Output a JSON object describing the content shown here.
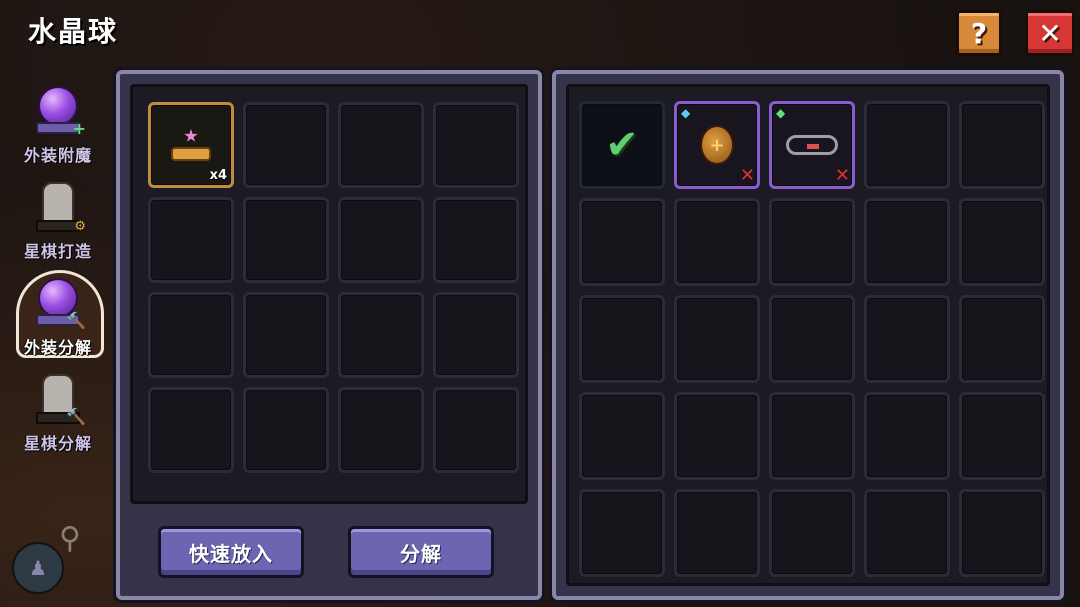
{
  "header": {
    "title": "水晶球",
    "help_label": "?",
    "close_label": "✕"
  },
  "colors": {
    "help_button": "#d88a3a",
    "close_button": "#d63636",
    "action_button": "#6c66b2",
    "panel": "#35324a"
  },
  "sidebar": {
    "items": [
      {
        "label": "外装附魔",
        "icon": "purple-crystal-orb-icon",
        "badge": "+",
        "active": false
      },
      {
        "label": "星棋打造",
        "icon": "stone-statue-icon",
        "badge": "⚙",
        "active": false
      },
      {
        "label": "外装分解",
        "icon": "purple-crystal-orb-icon",
        "badge": "🔨",
        "active": true
      },
      {
        "label": "星棋分解",
        "icon": "stone-statue-icon",
        "badge": "🔨",
        "active": false
      }
    ]
  },
  "left_panel": {
    "slots": [
      {
        "item": "pink-star-cake-icon",
        "quantity": "x4"
      }
    ],
    "buttons": {
      "quick_add": "快速放入",
      "decompose": "分解"
    }
  },
  "right_panel": {
    "slots": [
      {
        "item": "select-all-check-icon"
      },
      {
        "item": "bronze-shield-icon",
        "gem": "blue",
        "removable": true
      },
      {
        "item": "chain-bracelet-icon",
        "gem": "green",
        "removable": true
      }
    ],
    "remove_mark": "✕",
    "gem_mark": "◆"
  }
}
